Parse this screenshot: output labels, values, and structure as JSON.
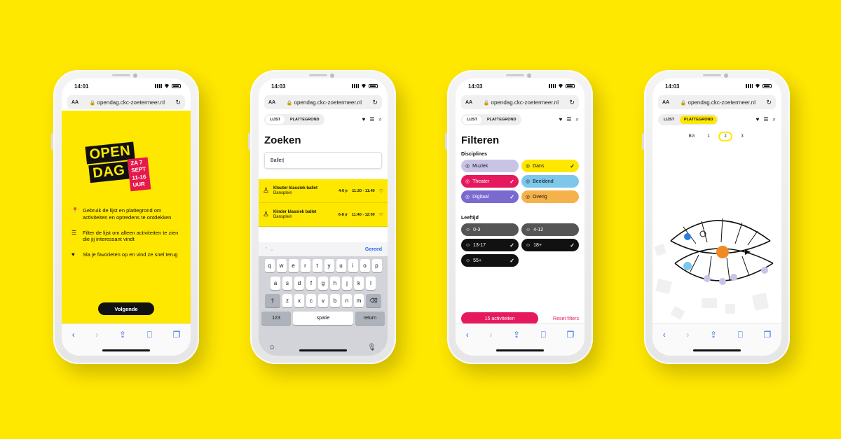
{
  "status_times": [
    "14:01",
    "14:03",
    "14:03",
    "14:03"
  ],
  "url": "opendag.ckc-zoetermeer.nl",
  "aa": "AA",
  "nav": {
    "lijst": "LIJST",
    "plattegrond": "PLATTEGROND"
  },
  "phone1": {
    "logo_line1": "OPEN",
    "logo_line2": "DAG",
    "logo_tag1": "ZA 7 SEPT",
    "logo_tag2": "11-16 UUR",
    "items": [
      "Gebruik de lijst en plattegrond om activiteiten en optredens te ontdekken",
      "Filter de lijst om alleen activiteiten te zien die jij interessant vindt",
      "Sla je favorieten op en vind ze snel terug"
    ],
    "button": "Volgende"
  },
  "phone2": {
    "title": "Zoeken",
    "search_value": "Ballet",
    "results": [
      {
        "name": "Kleuter klassiek ballet",
        "place": "Dansplein",
        "age": "4-6 jr",
        "time": "11:20 - 11:40"
      },
      {
        "name": "Kinder klassiek ballet",
        "place": "Dansplein",
        "age": "6-8 jr",
        "time": "11:40 - 12:00"
      }
    ],
    "done": "Gereed",
    "keys_row1": [
      "q",
      "w",
      "e",
      "r",
      "t",
      "y",
      "u",
      "i",
      "o",
      "p"
    ],
    "keys_row2": [
      "a",
      "s",
      "d",
      "f",
      "g",
      "h",
      "j",
      "k",
      "l"
    ],
    "keys_row3": [
      "z",
      "x",
      "c",
      "v",
      "b",
      "n",
      "m"
    ],
    "key_num": "123",
    "key_space": "spatie",
    "key_return": "return"
  },
  "phone3": {
    "title": "Filteren",
    "disciplines_label": "Disciplines",
    "disciplines": [
      {
        "label": "Muziek",
        "color": "#c9c4e6",
        "checked": false
      },
      {
        "label": "Dans",
        "color": "#ffe800",
        "checked": true
      },
      {
        "label": "Theater",
        "color": "#e6195e",
        "checked": true
      },
      {
        "label": "Beeldend",
        "color": "#7cc7ea",
        "checked": false
      },
      {
        "label": "Digitaal",
        "color": "#7a6ad0",
        "checked": true
      },
      {
        "label": "Overig",
        "color": "#f5b24a",
        "checked": false
      }
    ],
    "age_label": "Leeftijd",
    "ages": [
      {
        "label": "0-3",
        "checked": false
      },
      {
        "label": "4-12",
        "checked": false
      },
      {
        "label": "13-17",
        "checked": true
      },
      {
        "label": "18+",
        "checked": true
      },
      {
        "label": "55+",
        "checked": true
      }
    ],
    "activities_button": "15 activiteiten",
    "reset": "Reset filters"
  },
  "phone4": {
    "floors": [
      "BG",
      "1",
      "2",
      "3"
    ],
    "selected_floor": "2"
  }
}
